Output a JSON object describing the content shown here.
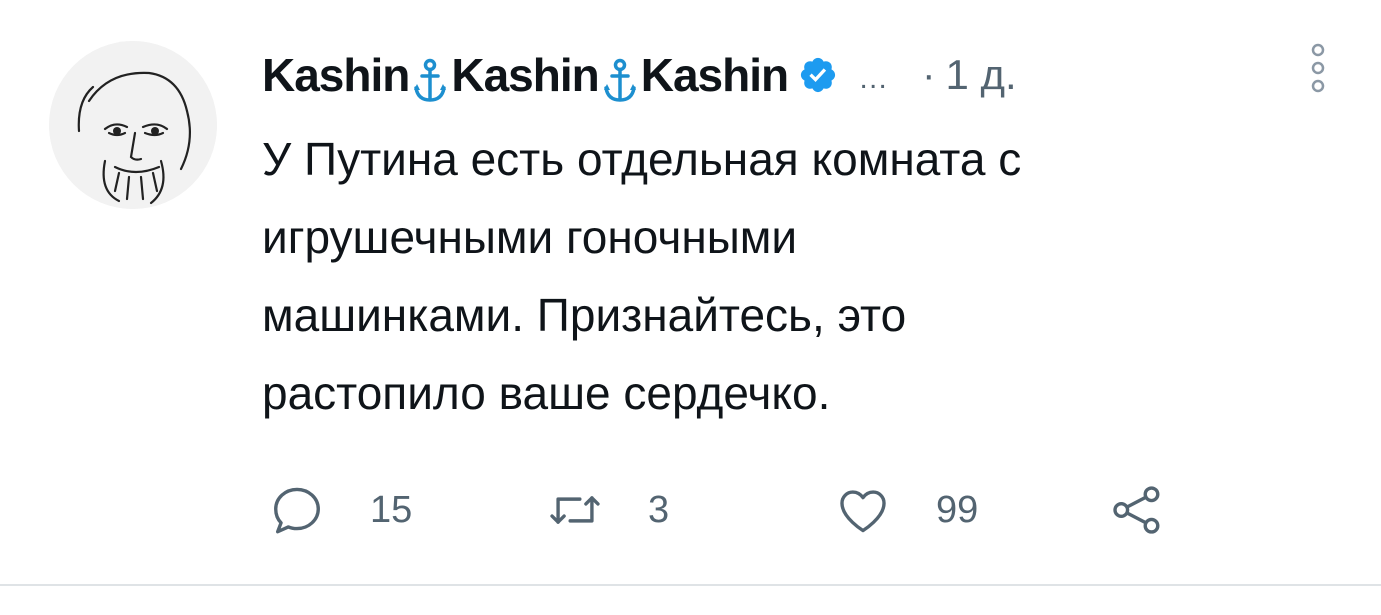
{
  "author": {
    "name_part": "Kashin",
    "verified_icon": "verified-badge-icon",
    "anchor_icon": "anchor-icon",
    "brand_color": "#1d9bf0"
  },
  "meta": {
    "ellipsis": "…",
    "separator": "·",
    "time": "1 д."
  },
  "tweet": {
    "lines": [
      "У Путина есть отдельная комната с",
      "игрушечными гоночными",
      "машинками. Признайтесь, это",
      "растопило ваше сердечко."
    ]
  },
  "actions": {
    "reply_count": "15",
    "retweet_count": "3",
    "like_count": "99",
    "icons": [
      "reply-icon",
      "retweet-icon",
      "like-icon",
      "share-icon"
    ]
  },
  "colors": {
    "text": "#0f1419",
    "secondary": "#536471",
    "divider": "#dfe3e6"
  }
}
